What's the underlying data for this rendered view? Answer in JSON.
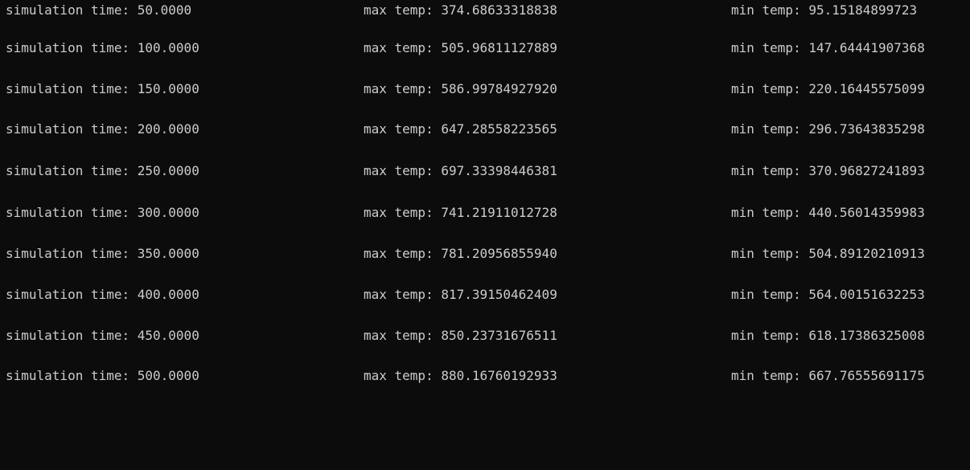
{
  "terminal": {
    "rows": [
      {
        "time": "simulation time: 50.0000",
        "max": "max temp: 374.68633318838",
        "min": "min temp: 95.15184899723"
      },
      {
        "time": "simulation time: 100.0000",
        "max": "max temp: 505.96811127889",
        "min": "min temp: 147.64441907368"
      },
      {
        "time": "simulation time: 150.0000",
        "max": "max temp: 586.99784927920",
        "min": "min temp: 220.16445575099"
      },
      {
        "time": "simulation time: 200.0000",
        "max": "max temp: 647.28558223565",
        "min": "min temp: 296.73643835298"
      },
      {
        "time": "simulation time: 250.0000",
        "max": "max temp: 697.33398446381",
        "min": "min temp: 370.96827241893"
      },
      {
        "time": "simulation time: 300.0000",
        "max": "max temp: 741.21911012728",
        "min": "min temp: 440.56014359983"
      },
      {
        "time": "simulation time: 350.0000",
        "max": "max temp: 781.20956855940",
        "min": "min temp: 504.89120210913"
      },
      {
        "time": "simulation time: 400.0000",
        "max": "max temp: 817.39150462409",
        "min": "min temp: 564.00151632253"
      },
      {
        "time": "simulation time: 450.0000",
        "max": "max temp: 850.23731676511",
        "min": "min temp: 618.17386325008"
      },
      {
        "time": "simulation time: 500.0000",
        "max": "max temp: 880.16760192933",
        "min": "min temp: 667.76555691175"
      }
    ]
  },
  "colors": {
    "background": "#0c0c0c",
    "text": "#cccccc"
  }
}
